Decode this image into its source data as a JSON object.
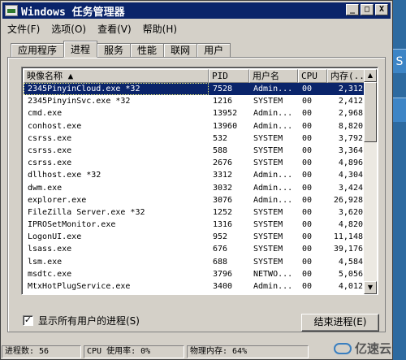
{
  "window": {
    "title": "Windows 任务管理器",
    "buttons": {
      "minimize": "_",
      "maximize": "□",
      "close": "X"
    }
  },
  "menubar": [
    {
      "label": "文件(F)"
    },
    {
      "label": "选项(O)"
    },
    {
      "label": "查看(V)"
    },
    {
      "label": "帮助(H)"
    }
  ],
  "tabs": [
    {
      "label": "应用程序",
      "active": false
    },
    {
      "label": "进程",
      "active": true
    },
    {
      "label": "服务",
      "active": false
    },
    {
      "label": "性能",
      "active": false
    },
    {
      "label": "联网",
      "active": false
    },
    {
      "label": "用户",
      "active": false
    }
  ],
  "columns": [
    "映像名称 ▲",
    "PID",
    "用户名",
    "CPU",
    "内存(..."
  ],
  "processes": [
    {
      "name": "2345PinyinCloud.exe *32",
      "pid": "7528",
      "user": "Admin...",
      "cpu": "00",
      "mem": "2,312",
      "selected": true
    },
    {
      "name": "2345PinyinSvc.exe *32",
      "pid": "1216",
      "user": "SYSTEM",
      "cpu": "00",
      "mem": "2,412"
    },
    {
      "name": "cmd.exe",
      "pid": "13952",
      "user": "Admin...",
      "cpu": "00",
      "mem": "2,968"
    },
    {
      "name": "conhost.exe",
      "pid": "13960",
      "user": "Admin...",
      "cpu": "00",
      "mem": "8,820"
    },
    {
      "name": "csrss.exe",
      "pid": "532",
      "user": "SYSTEM",
      "cpu": "00",
      "mem": "3,792"
    },
    {
      "name": "csrss.exe",
      "pid": "588",
      "user": "SYSTEM",
      "cpu": "00",
      "mem": "3,364"
    },
    {
      "name": "csrss.exe",
      "pid": "2676",
      "user": "SYSTEM",
      "cpu": "00",
      "mem": "4,896"
    },
    {
      "name": "dllhost.exe *32",
      "pid": "3312",
      "user": "Admin...",
      "cpu": "00",
      "mem": "4,304"
    },
    {
      "name": "dwm.exe",
      "pid": "3032",
      "user": "Admin...",
      "cpu": "00",
      "mem": "3,424"
    },
    {
      "name": "explorer.exe",
      "pid": "3076",
      "user": "Admin...",
      "cpu": "00",
      "mem": "26,928"
    },
    {
      "name": "FileZilla Server.exe *32",
      "pid": "1252",
      "user": "SYSTEM",
      "cpu": "00",
      "mem": "3,620"
    },
    {
      "name": "IPROSetMonitor.exe",
      "pid": "1316",
      "user": "SYSTEM",
      "cpu": "00",
      "mem": "4,820"
    },
    {
      "name": "LogonUI.exe",
      "pid": "952",
      "user": "SYSTEM",
      "cpu": "00",
      "mem": "11,148"
    },
    {
      "name": "lsass.exe",
      "pid": "676",
      "user": "SYSTEM",
      "cpu": "00",
      "mem": "39,176"
    },
    {
      "name": "lsm.exe",
      "pid": "688",
      "user": "SYSTEM",
      "cpu": "00",
      "mem": "4,584"
    },
    {
      "name": "msdtc.exe",
      "pid": "3796",
      "user": "NETWO...",
      "cpu": "00",
      "mem": "5,056"
    },
    {
      "name": "MtxHotPlugService.exe",
      "pid": "3400",
      "user": "Admin...",
      "cpu": "00",
      "mem": "4,012"
    }
  ],
  "show_all_users": {
    "label": "显示所有用户的进程(S)",
    "checked": true,
    "mark": "✓"
  },
  "end_process_button": "结束进程(E)",
  "statusbar": {
    "processes": "进程数: 56",
    "cpu": "CPU 使用率: 0%",
    "memory": "物理内存: 64%"
  },
  "watermark": "亿速云"
}
